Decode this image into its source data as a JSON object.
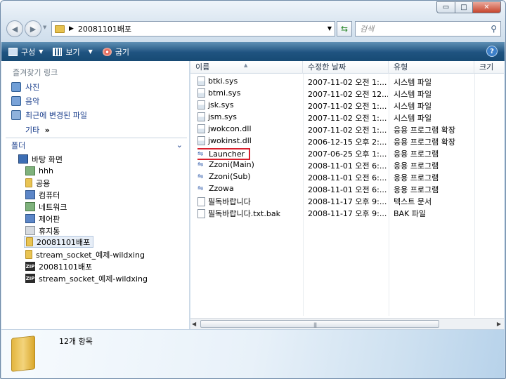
{
  "window": {
    "caption_buttons": {
      "minimize": "▭",
      "maximize": "□",
      "close": "✕"
    }
  },
  "address": {
    "path": "20081101배포",
    "search_placeholder": "검색"
  },
  "toolbar": {
    "organize": "구성",
    "views": "보기",
    "burn": "굽기",
    "help": "?"
  },
  "favorites": {
    "header": "즐겨찾기 링크",
    "items": [
      "사진",
      "음악",
      "최근에 변경된 파일"
    ],
    "more": "기타",
    "more_arrow": "»"
  },
  "folders": {
    "header": "폴더",
    "tree": [
      {
        "label": "바탕 화면",
        "icon": "desktop-icon"
      },
      {
        "label": "hhh",
        "icon": "user-folder-icon"
      },
      {
        "label": "공용",
        "icon": "folder-icon"
      },
      {
        "label": "컴퓨터",
        "icon": "computer-icon"
      },
      {
        "label": "네트워크",
        "icon": "network-icon"
      },
      {
        "label": "제어판",
        "icon": "control-panel-icon"
      },
      {
        "label": "휴지통",
        "icon": "recycle-bin-icon"
      },
      {
        "label": "20081101배포",
        "icon": "folder-icon",
        "selected": true
      },
      {
        "label": "stream_socket_예제-wildxing",
        "icon": "folder-icon"
      },
      {
        "label": "20081101배포",
        "icon": "zip-icon"
      },
      {
        "label": "stream_socket_예제-wildxing",
        "icon": "zip-icon"
      }
    ]
  },
  "columns": [
    "이름",
    "수정한 날짜",
    "유형",
    "크기"
  ],
  "files": [
    {
      "name": "btki.sys",
      "date": "2007-11-02 오전 1:...",
      "type": "시스템 파일",
      "icon": "sys-file-icon"
    },
    {
      "name": "btmi.sys",
      "date": "2007-11-02 오전 12...",
      "type": "시스템 파일",
      "icon": "sys-file-icon"
    },
    {
      "name": "jsk.sys",
      "date": "2007-11-02 오전 1:...",
      "type": "시스템 파일",
      "icon": "sys-file-icon"
    },
    {
      "name": "jsm.sys",
      "date": "2007-11-02 오전 1:...",
      "type": "시스템 파일",
      "icon": "sys-file-icon"
    },
    {
      "name": "jwokcon.dll",
      "date": "2007-11-02 오전 1:...",
      "type": "응용 프로그램 확장",
      "icon": "dll-file-icon"
    },
    {
      "name": "jwokinst.dll",
      "date": "2006-12-15 오후 2:...",
      "type": "응용 프로그램 확장",
      "icon": "dll-file-icon"
    },
    {
      "name": "Launcher",
      "date": "2007-06-25 오후 1:...",
      "type": "응용 프로그램",
      "icon": "bluetooth-exe-icon",
      "highlighted": true
    },
    {
      "name": "Zzoni(Main)",
      "date": "2008-11-01 오전 6:...",
      "type": "응용 프로그램",
      "icon": "bluetooth-exe-icon"
    },
    {
      "name": "Zzoni(Sub)",
      "date": "2008-11-01 오전 6:...",
      "type": "응용 프로그램",
      "icon": "bluetooth-exe-icon"
    },
    {
      "name": "Zzowa",
      "date": "2008-11-01 오전 6:...",
      "type": "응용 프로그램",
      "icon": "bluetooth-exe-icon"
    },
    {
      "name": "필독바랍니다",
      "date": "2008-11-17 오후 9:...",
      "type": "텍스트 문서",
      "icon": "text-file-icon"
    },
    {
      "name": "필독바랍니다.txt.bak",
      "date": "2008-11-17 오후 9:...",
      "type": "BAK 파일",
      "icon": "blank-file-icon"
    }
  ],
  "status": {
    "count": "12개 항목"
  },
  "colors": {
    "toolbar": "#1f5380",
    "link": "#1a3e8c",
    "highlight_border": "#d8202d"
  }
}
